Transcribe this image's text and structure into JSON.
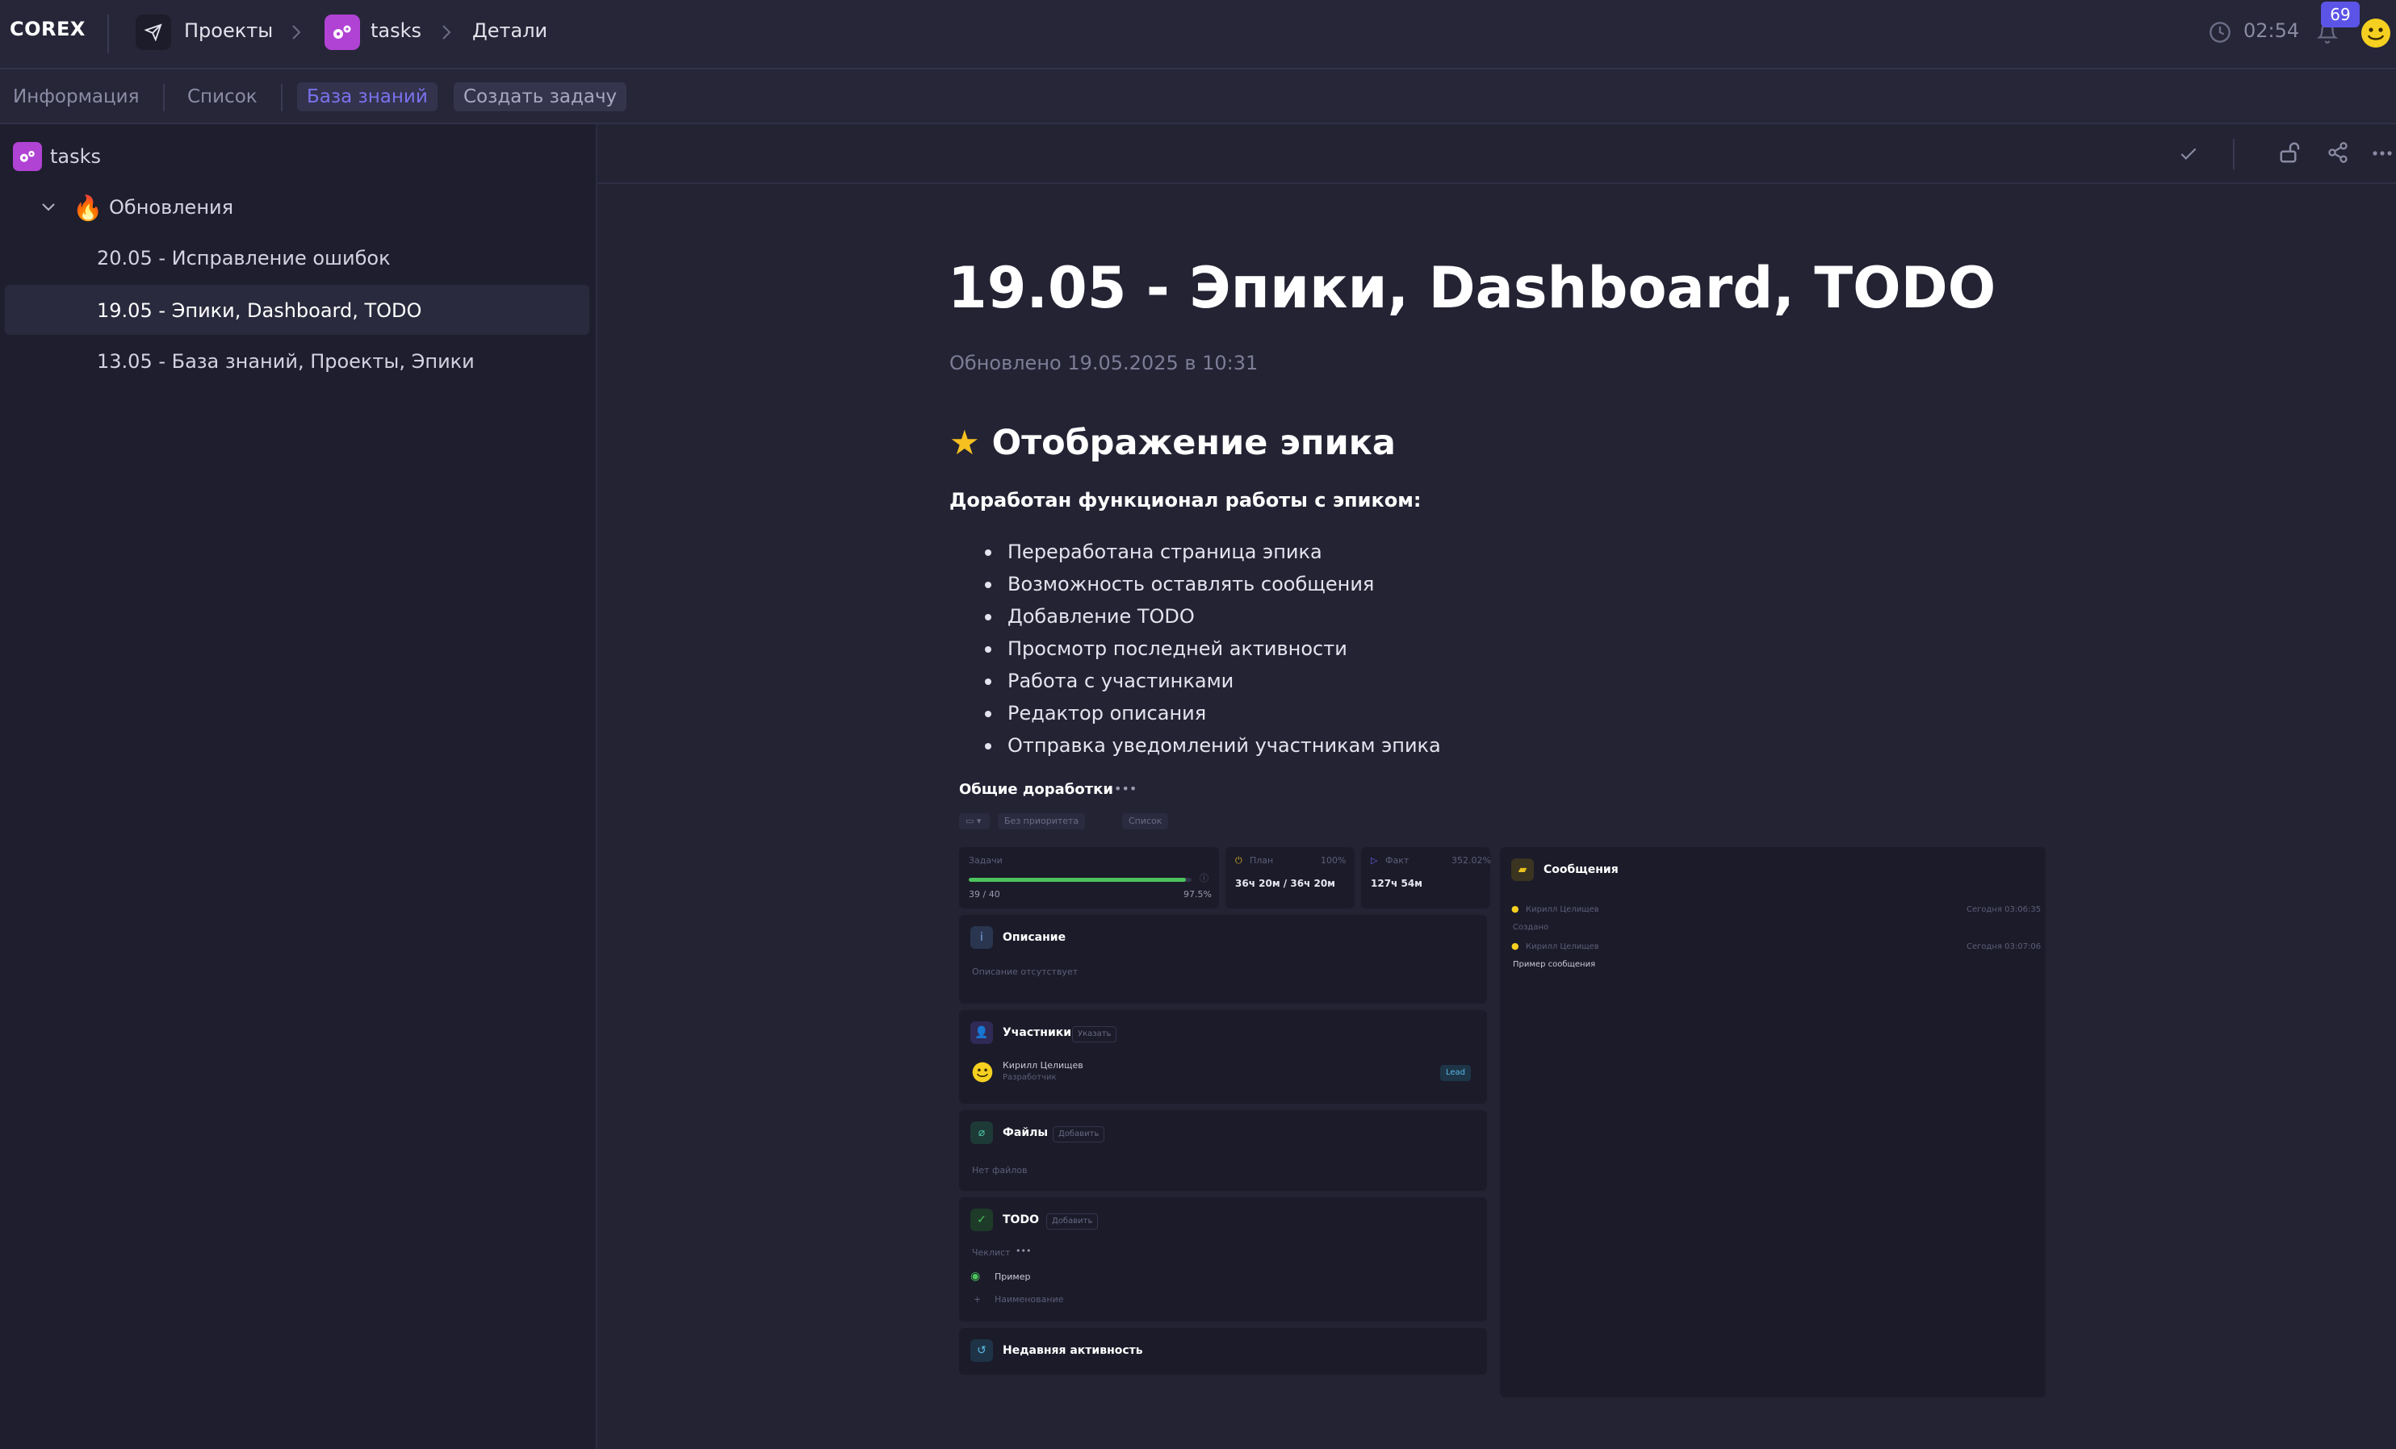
{
  "app": {
    "logo": "COREX"
  },
  "breadcrumbs": [
    {
      "label": "Проекты",
      "icon": "send-icon"
    },
    {
      "label": "tasks",
      "icon": "gears-icon"
    },
    {
      "label": "Детали"
    }
  ],
  "header": {
    "clock": "02:54",
    "notifications_count": "69"
  },
  "tabs": [
    {
      "label": "Информация",
      "active": false
    },
    {
      "label": "Список",
      "active": false
    },
    {
      "label": "База знаний",
      "active": true
    },
    {
      "label": "Создать задачу",
      "active": false
    }
  ],
  "sidebar": {
    "root": "tasks",
    "folder": {
      "icon": "fire-icon",
      "label": "Обновления"
    },
    "items": [
      {
        "label": "20.05 - Исправление ошибок",
        "selected": false
      },
      {
        "label": "19.05 - Эпики, Dashboard, TODO",
        "selected": true
      },
      {
        "label": "13.05 - База знаний, Проекты, Эпики",
        "selected": false
      }
    ]
  },
  "toolbar": {
    "icons": [
      "check-icon",
      "unlock-icon",
      "share-icon",
      "more-icon"
    ]
  },
  "document": {
    "title": "19.05 - Эпики, Dashboard, TODO",
    "updated": "Обновлено 19.05.2025 в 10:31",
    "section_title": "Отображение эпика",
    "section_icon": "star-icon",
    "lead": "Доработан функционал работы с эпиком:",
    "bullets": [
      "Переработана страница эпика",
      "Возможность оставлять сообщения",
      "Добавление TODO",
      "Просмотр последней активности",
      "Работа с участинками",
      "Редактор описания",
      "Отправка уведомлений участникам эпика"
    ]
  },
  "embed": {
    "title": "Общие доработки",
    "chips": [
      "Без приоритета",
      "Список"
    ],
    "tasks": {
      "label": "Задачи",
      "count": "39 / 40",
      "percent": "97.5%",
      "progress": 0.975
    },
    "plan": {
      "label": "План",
      "percent": "100%",
      "value": "36ч 20м / 36ч 20м"
    },
    "fact": {
      "label": "Факт",
      "percent": "352.02%",
      "value": "127ч 54м"
    },
    "description": {
      "title": "Описание",
      "empty": "Описание отсутствует"
    },
    "members": {
      "title": "Участники",
      "action": "Указать",
      "name": "Кирилл Целищев",
      "role": "Разработчик",
      "badge": "Lead"
    },
    "files": {
      "title": "Файлы",
      "action": "Добавить",
      "empty": "Нет файлов"
    },
    "todo": {
      "title": "TODO",
      "action": "Добавить",
      "list": "Чеклист",
      "item": "Пример",
      "placeholder": "Наименование"
    },
    "activity": {
      "title": "Недавняя активность"
    },
    "messages": {
      "title": "Сообщения",
      "entries": [
        {
          "author": "Кирилл Целищев",
          "time": "Сегодня 03:06:35",
          "text": "Создано"
        },
        {
          "author": "Кирилл Целищев",
          "time": "Сегодня 03:07:06",
          "text": "Пример сообщения"
        }
      ]
    }
  }
}
